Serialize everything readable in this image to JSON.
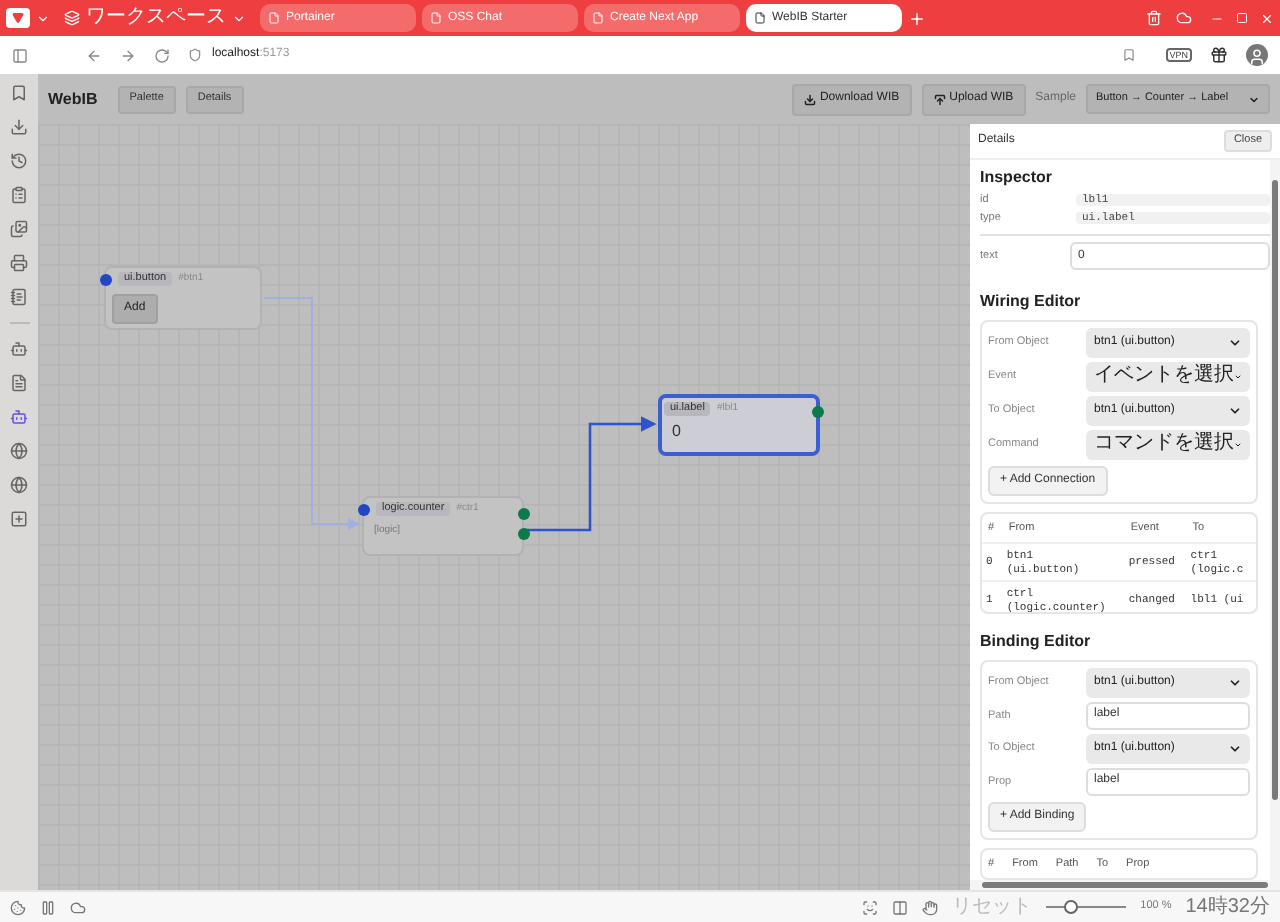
{
  "browser": {
    "workspace": "ワークスペース",
    "tabs": [
      {
        "title": "Portainer",
        "selected": false
      },
      {
        "title": "OSS Chat",
        "selected": false
      },
      {
        "title": "Create Next App",
        "selected": false
      },
      {
        "title": "WebIB Starter",
        "selected": true
      }
    ],
    "address": {
      "host": "localhost",
      "port": ":5173"
    },
    "vpn": "VPN"
  },
  "app": {
    "title": "WebIB",
    "buttons": [
      "Palette",
      "Details"
    ],
    "download": "Download WIB",
    "upload": "Upload WIB",
    "sample_label": "Sample",
    "sample_value": "Button → Counter → Label"
  },
  "nodes": [
    {
      "kind": "button",
      "type": "ui.button",
      "id": "#btn1",
      "body": "Add",
      "selected": false
    },
    {
      "kind": "logic",
      "type": "logic.counter",
      "id": "#ctr1",
      "body": "[logic]",
      "selected": false
    },
    {
      "kind": "label",
      "type": "ui.label",
      "id": "#lbl1",
      "body": "0",
      "selected": true
    }
  ],
  "details": {
    "title": "Details",
    "close": "Close",
    "inspector": {
      "heading": "Inspector",
      "fields": [
        {
          "label": "id",
          "value": "lbl1"
        },
        {
          "label": "type",
          "value": "ui.label"
        }
      ],
      "text": {
        "label": "text",
        "value": "0"
      }
    },
    "wiring": {
      "heading": "Wiring Editor",
      "fields": [
        {
          "label": "From Object",
          "value": "btn1 (ui.button)"
        },
        {
          "label": "Event",
          "value": "イベントを選択"
        },
        {
          "label": "To Object",
          "value": "btn1 (ui.button)"
        },
        {
          "label": "Command",
          "value": "コマンドを選択"
        }
      ],
      "add": "+ Add Connection",
      "table": {
        "columns": [
          "#",
          "From",
          "Event",
          "To"
        ],
        "rows": [
          [
            "0",
            "btn1\n(ui.button)",
            "pressed",
            "ctr1\n(logic.c"
          ],
          [
            "1",
            "ctrl\n(logic.counter)",
            "changed",
            "lbl1 (ui"
          ]
        ]
      }
    },
    "binding": {
      "heading": "Binding Editor",
      "fields": [
        {
          "kind": "select",
          "label": "From Object",
          "value": "btn1 (ui.button)"
        },
        {
          "kind": "input",
          "label": "Path",
          "value": "label"
        },
        {
          "kind": "select",
          "label": "To Object",
          "value": "btn1 (ui.button)"
        },
        {
          "kind": "input",
          "label": "Prop",
          "value": "label"
        }
      ],
      "add": "+ Add Binding",
      "table": {
        "columns": [
          "#",
          "From",
          "Path",
          "To",
          "Prop"
        ]
      }
    }
  },
  "status": {
    "reset": "リセット",
    "zoom": {
      "level": 0.3
    },
    "zoom_text": "100 %",
    "time": "14時32分"
  }
}
